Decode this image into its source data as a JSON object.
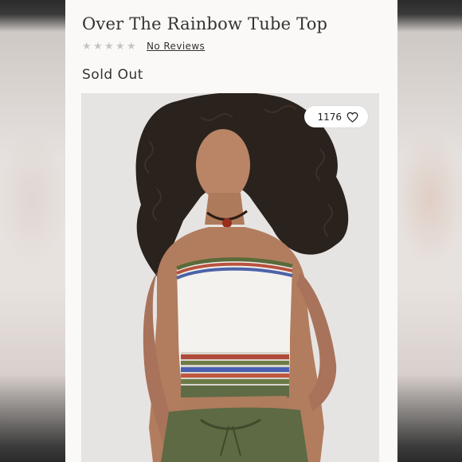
{
  "product": {
    "title": "Over The Rainbow Tube Top",
    "rating": {
      "stars": 5,
      "filled": 0,
      "reviews_label": "No Reviews"
    },
    "status": "Sold Out",
    "favorites": {
      "count": "1176",
      "icon": "heart-icon"
    }
  },
  "colors": {
    "card_bg": "#fbf9f8",
    "text": "#333333",
    "star_empty": "#c8c5c2",
    "photo_bg": "#e5e3e1"
  }
}
